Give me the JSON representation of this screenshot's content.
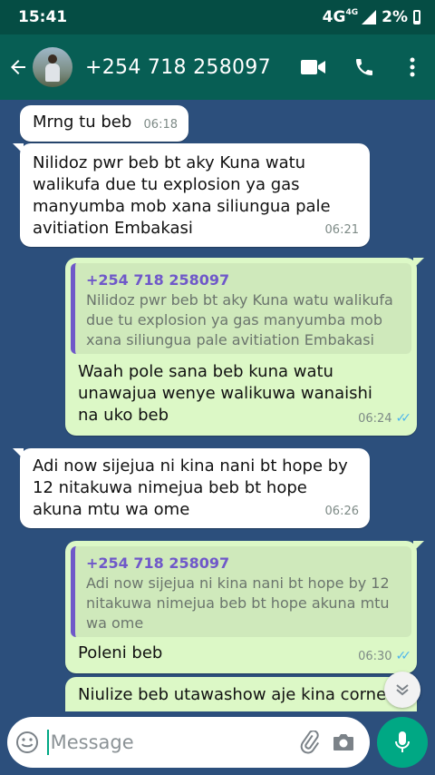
{
  "status_bar": {
    "time": "15:41",
    "network": "4G",
    "network_sup": "4G",
    "battery": "2%"
  },
  "app_bar": {
    "contact": "+254 718 258097"
  },
  "messages": [
    {
      "text": "Mrng tu beb",
      "time": "06:18"
    },
    {
      "text": "Nilidoz pwr beb bt aky Kuna watu walikufa due tu explosion ya gas manyumba mob xana siliungua pale avitiation Embakasi",
      "time": "06:21"
    },
    {
      "quote_name": "+254 718 258097",
      "quote_text": "Nilidoz pwr beb bt aky Kuna watu walikufa due tu explosion ya gas manyumba mob xana siliungua pale avitiation Embakasi",
      "text": "Waah pole sana beb kuna watu unawajua wenye walikuwa wanaishi na uko beb",
      "time": "06:24"
    },
    {
      "text": "Adi now sijejua ni kina nani bt hope by 12 nitakuwa nimejua beb bt hope akuna mtu wa ome",
      "time": "06:26"
    },
    {
      "quote_name": "+254 718 258097",
      "quote_text": "Adi now sijejua ni kina nani bt hope by 12 nitakuwa nimejua beb bt hope akuna mtu wa ome",
      "text": "Poleni beb",
      "time": "06:30"
    },
    {
      "text": "Niulize beb utawashow aje kina corne"
    }
  ],
  "input": {
    "placeholder": "Message"
  },
  "colors": {
    "header": "#075e54",
    "statusbar": "#054d44",
    "outgoing": "#dcf8c6",
    "incoming": "#ffffff",
    "quote_accent": "#6f58c9",
    "mic": "#00a884",
    "wallpaper": "#2c4f7c"
  },
  "icons": [
    "back-arrow-icon",
    "video-call-icon",
    "phone-icon",
    "more-vert-icon",
    "emoji-icon",
    "attach-icon",
    "camera-icon",
    "mic-icon",
    "chevron-down-icon",
    "double-check-icon"
  ]
}
